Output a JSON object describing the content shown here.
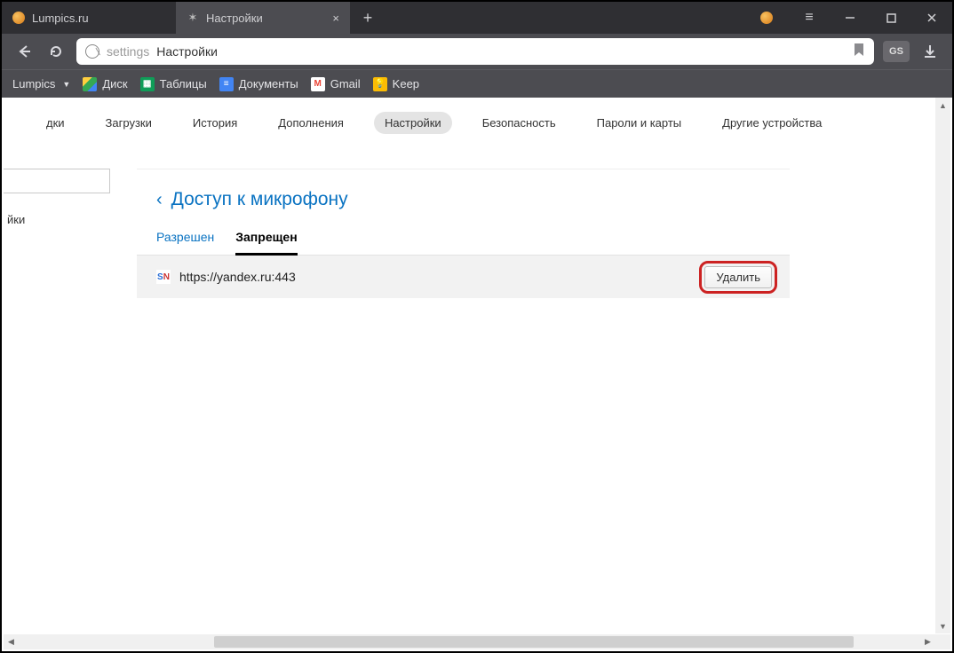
{
  "tabs": [
    {
      "label": "Lumpics.ru"
    },
    {
      "label": "Настройки"
    }
  ],
  "addressbar": {
    "seg_settings": "settings",
    "seg_title": "Настройки"
  },
  "bookmarks": {
    "site": "Lumpics",
    "drive": "Диск",
    "sheets": "Таблицы",
    "docs": "Документы",
    "gmail": "Gmail",
    "keep": "Keep"
  },
  "settings_nav": {
    "items": [
      "дки",
      "Загрузки",
      "История",
      "Дополнения",
      "Настройки",
      "Безопасность",
      "Пароли и карты",
      "Другие устройства"
    ]
  },
  "sidebar": {
    "item_cropped": "йки"
  },
  "main": {
    "title": "Доступ к микрофону",
    "tabs": {
      "allowed": "Разрешен",
      "denied": "Запрещен"
    },
    "site_url": "https://yandex.ru:443",
    "site_badge": {
      "s": "S",
      "n": "N"
    },
    "delete_label": "Удалить"
  },
  "ext_badge": "GS"
}
